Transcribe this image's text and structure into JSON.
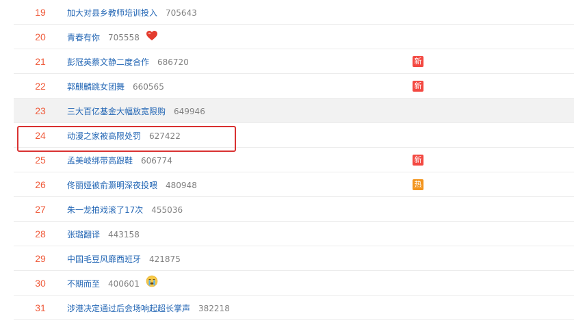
{
  "rows": [
    {
      "rank": "19",
      "title": "加大对县乡教师培训投入",
      "count": "705643"
    },
    {
      "rank": "20",
      "title": "青春有你",
      "count": "705558"
    },
    {
      "rank": "21",
      "title": "彭冠英蔡文静二度合作",
      "count": "686720",
      "badge": "新"
    },
    {
      "rank": "22",
      "title": "郭麒麟跳女团舞",
      "count": "660565",
      "badge": "新"
    },
    {
      "rank": "23",
      "title": "三大百亿基金大幅放宽限购",
      "count": "649946"
    },
    {
      "rank": "24",
      "title": "动漫之家被高限处罚",
      "count": "627422"
    },
    {
      "rank": "25",
      "title": "孟美岐绑带高跟鞋",
      "count": "606774",
      "badge": "新"
    },
    {
      "rank": "26",
      "title": "佟丽娅被俞灏明深夜投喂",
      "count": "480948",
      "badge": "热"
    },
    {
      "rank": "27",
      "title": "朱一龙拍戏滚了17次",
      "count": "455036"
    },
    {
      "rank": "28",
      "title": "张璐翻译",
      "count": "443158"
    },
    {
      "rank": "29",
      "title": "中国毛豆风靡西班牙",
      "count": "421875"
    },
    {
      "rank": "30",
      "title": "不期而至",
      "count": "400601"
    },
    {
      "rank": "31",
      "title": "涉港决定通过后会场响起超长掌声",
      "count": "382218"
    }
  ],
  "colors": {
    "rank": "#ef5a3a",
    "link": "#2467b5",
    "count": "#808080",
    "badge_new": "#f34841",
    "badge_hot": "#f3951d",
    "highlight": "#d93131"
  },
  "icons": {
    "row_20": "heart-icon",
    "row_30": "crying-face-icon"
  }
}
